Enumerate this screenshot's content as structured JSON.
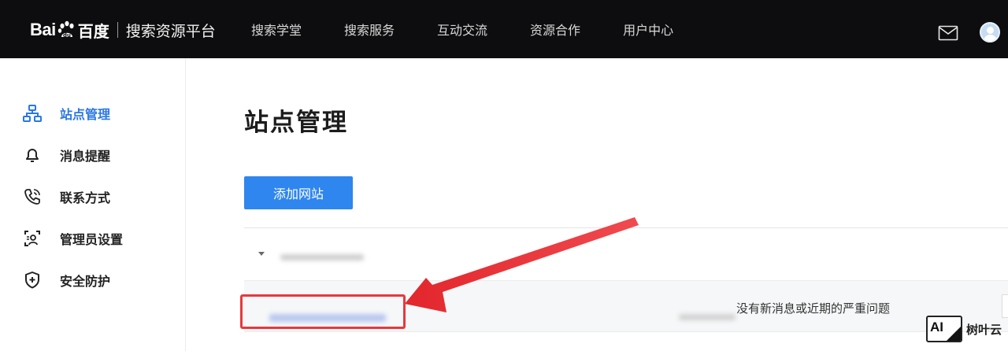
{
  "header": {
    "logo": {
      "bai": "Bai",
      "du_cn": "百度",
      "platform": "搜索资源平台"
    },
    "nav": [
      "搜索学堂",
      "搜索服务",
      "互动交流",
      "资源合作",
      "用户中心"
    ]
  },
  "sidebar": {
    "items": [
      {
        "label": "站点管理",
        "icon": "site-tree-icon",
        "active": true
      },
      {
        "label": "消息提醒",
        "icon": "bell-icon",
        "active": false
      },
      {
        "label": "联系方式",
        "icon": "phone-icon",
        "active": false
      },
      {
        "label": "管理员设置",
        "icon": "admin-card-icon",
        "active": false
      },
      {
        "label": "安全防护",
        "icon": "shield-plus-icon",
        "active": false
      }
    ]
  },
  "main": {
    "title": "站点管理",
    "add_button": "添加网站",
    "site_row": {
      "status": "没有新消息或近期的严重问题"
    }
  },
  "watermark": {
    "badge": "AI",
    "text": "树叶云"
  },
  "colors": {
    "accent": "#2e86ee",
    "annotation": "#e8383d",
    "topbar": "#0d0d0f"
  }
}
